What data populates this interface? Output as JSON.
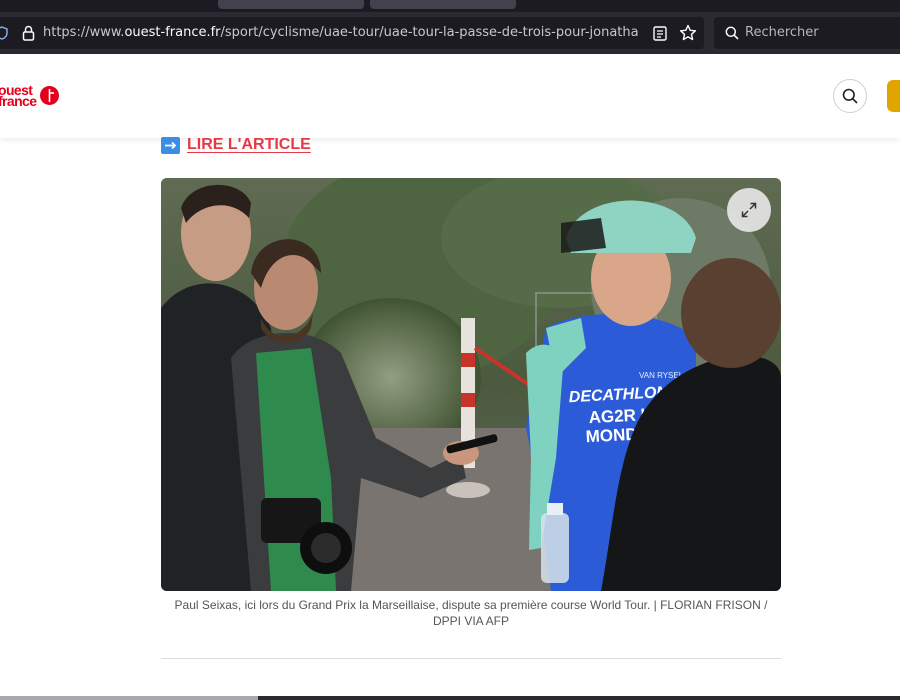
{
  "browser": {
    "url_prefix": "https://www.",
    "url_host": "ouest-france.fr",
    "url_path": "/sport/cyclisme/uae-tour/uae-tour-la-passe-de-trois-pour-jonathan-m",
    "search_placeholder": "Rechercher"
  },
  "header": {
    "logo_text": "ouest\nfrance"
  },
  "article": {
    "read_link": "LIRE L'ARTICLE",
    "caption": "Paul Seixas, ici lors du Grand Prix la Marseillaise, dispute sa première course World Tour. | FLORIAN FRISON / DPPI VIA AFP",
    "jersey_line1": "DECATHLON",
    "jersey_line2": "AG2R LA",
    "jersey_line3": "MONDIALE",
    "jersey_small": "VAN RYSEL"
  },
  "colors": {
    "brand_red": "#e2001a",
    "link_red": "#e63946",
    "jersey_blue": "#2b5bd7",
    "jersey_mint": "#7fd1c0",
    "accent_yellow": "#e0a500"
  }
}
